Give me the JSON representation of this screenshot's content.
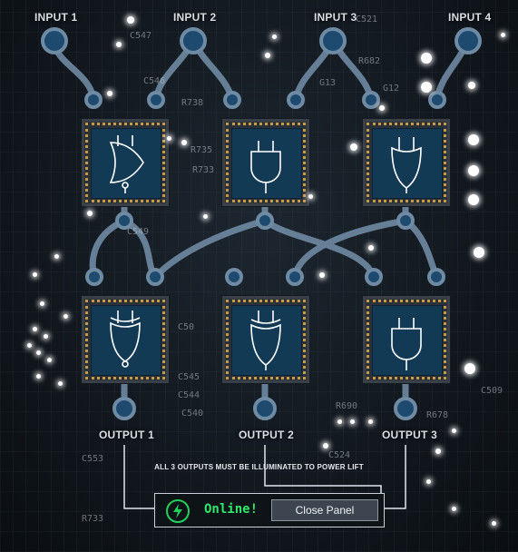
{
  "inputs": [
    {
      "label": "INPUT 1",
      "active": true
    },
    {
      "label": "INPUT 2",
      "active": false
    },
    {
      "label": "INPUT 3",
      "active": true
    },
    {
      "label": "INPUT 4",
      "active": false
    }
  ],
  "outputs": [
    {
      "label": "OUTPUT 1"
    },
    {
      "label": "OUTPUT 2"
    },
    {
      "label": "OUTPUT 3"
    }
  ],
  "gates": {
    "top": [
      "nor",
      "and",
      "or"
    ],
    "bottom": [
      "xnor",
      "xor",
      "and"
    ]
  },
  "silkscreen": [
    "C547",
    "C546",
    "R738",
    "R735",
    "R733",
    "C521",
    "G13",
    "R682",
    "G12",
    "C549",
    "C50",
    "C545",
    "C544",
    "C540",
    "R690",
    "C524",
    "C553",
    "R733",
    "R678",
    "C509"
  ],
  "instruction": "ALL 3 OUTPUTS MUST BE ILLUMINATED TO POWER LIFT",
  "panel": {
    "status": "Online!",
    "close_label": "Close Panel",
    "status_color": "#2ee86a"
  },
  "colors": {
    "wire": "#6f8aa3",
    "node": "#1d4a6e",
    "die": "#123a55",
    "pins": "#c79a45"
  }
}
